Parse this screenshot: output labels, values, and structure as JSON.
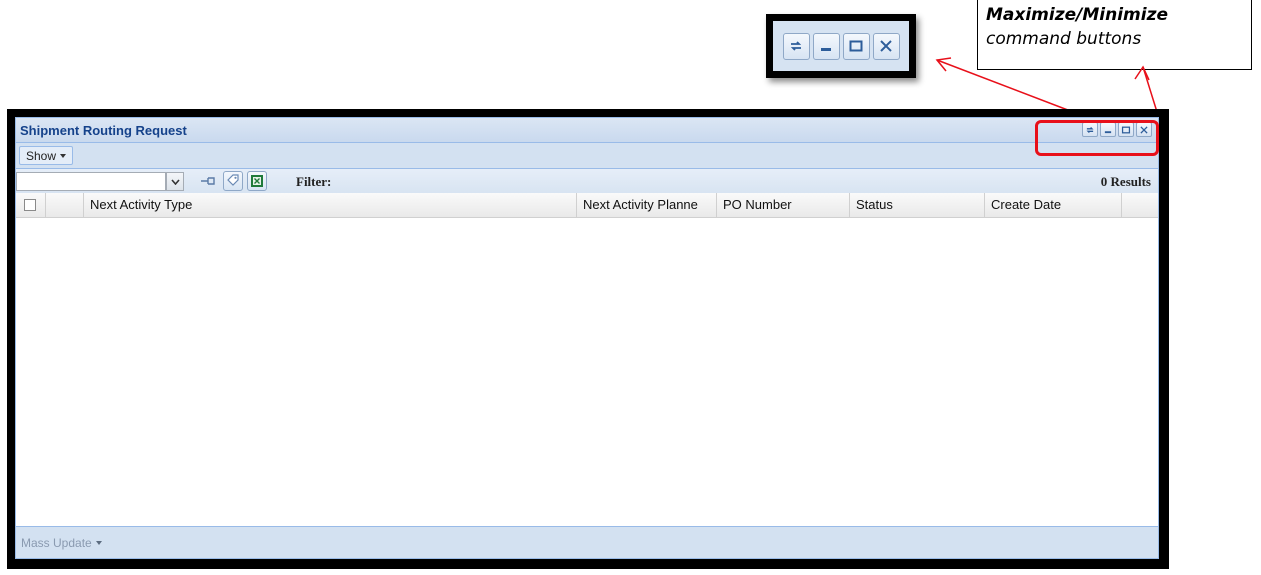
{
  "annotation": {
    "line1": "Maximize/Minimize",
    "line2": "command buttons"
  },
  "zoom_icons": [
    "refresh-icon",
    "minimize-icon",
    "maximize-icon",
    "close-icon"
  ],
  "window": {
    "title": "Shipment Routing Request",
    "tools": [
      "refresh-icon",
      "minimize-icon",
      "maximize-icon",
      "close-icon"
    ]
  },
  "menubar": {
    "show_label": "Show"
  },
  "toolbar": {
    "combo_value": "",
    "filter_label": "Filter:",
    "results_label": "0 Results"
  },
  "grid": {
    "columns": [
      "Next Activity Type",
      "Next Activity Planne",
      "PO Number",
      "Status",
      "Create Date"
    ],
    "rows": []
  },
  "footer": {
    "mass_update_label": "Mass Update"
  },
  "colors": {
    "title_text": "#15428b",
    "highlight": "#e8101a",
    "panel_border": "#99bbe8"
  }
}
